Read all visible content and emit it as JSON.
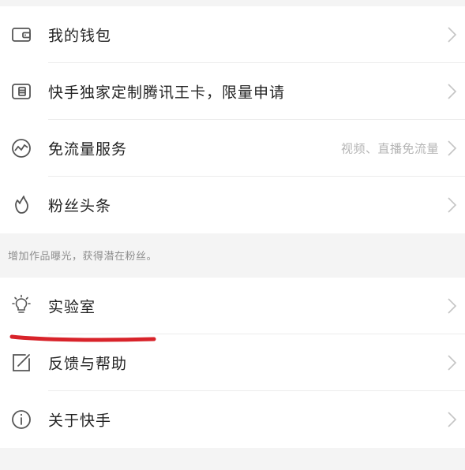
{
  "menu_group_1": [
    {
      "label": "我的钱包",
      "hint": "",
      "icon": "wallet-icon"
    },
    {
      "label": "快手独家定制腾讯王卡，限量申请",
      "hint": "",
      "icon": "sim-card-icon"
    },
    {
      "label": "免流量服务",
      "hint": "视频、直播免流量",
      "icon": "data-wave-icon"
    },
    {
      "label": "粉丝头条",
      "hint": "",
      "icon": "flame-icon"
    }
  ],
  "section_note": "增加作品曝光，获得潜在粉丝。",
  "menu_group_2": [
    {
      "label": "实验室",
      "hint": "",
      "icon": "lightbulb-icon"
    },
    {
      "label": "反馈与帮助",
      "hint": "",
      "icon": "edit-icon"
    },
    {
      "label": "关于快手",
      "hint": "",
      "icon": "info-icon"
    }
  ],
  "colors": {
    "background": "#f4f4f4",
    "row_background": "#ffffff",
    "text": "#222222",
    "hint_text": "#b4b4b4",
    "note_text": "#8e8e8e",
    "icon_stroke": "#555555",
    "chevron": "#c4c4c4",
    "annotation_red": "#d8232a"
  }
}
